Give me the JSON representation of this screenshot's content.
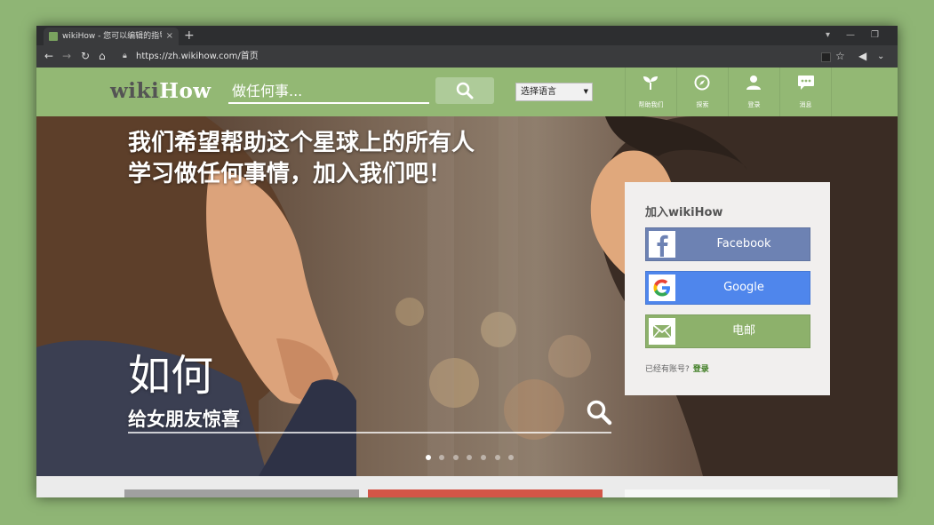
{
  "browser": {
    "tab_title": "wikiHow - 您可以编辑的指导手册",
    "tab_close": "×",
    "new_tab": "+",
    "url": "https://zh.wikihow.com/首页",
    "window_controls": [
      "▾",
      "—",
      "❐"
    ]
  },
  "header": {
    "logo_wiki": "wiki",
    "logo_how": "How",
    "search_placeholder": "做任何事...",
    "language_select": "选择语言",
    "nav": [
      "帮助我们",
      "探索",
      "登录",
      "消息"
    ]
  },
  "hero": {
    "headline_line1": "我们希望帮助这个星球上的所有人",
    "headline_line2": "学习做任何事情，加入我们吧！",
    "how_to": "如何",
    "subtitle": "给女朋友惊喜",
    "slides_total": 7,
    "slide_active": 1
  },
  "login_card": {
    "title": "加入wikiHow",
    "facebook": "Facebook",
    "google": "Google",
    "email": "电邮",
    "have_account": "已经有账号?",
    "login": "登录"
  },
  "colors": {
    "brand_green": "#93b874",
    "facebook": "#6d82b3",
    "google": "#4f86ec",
    "email": "#8db16b"
  }
}
